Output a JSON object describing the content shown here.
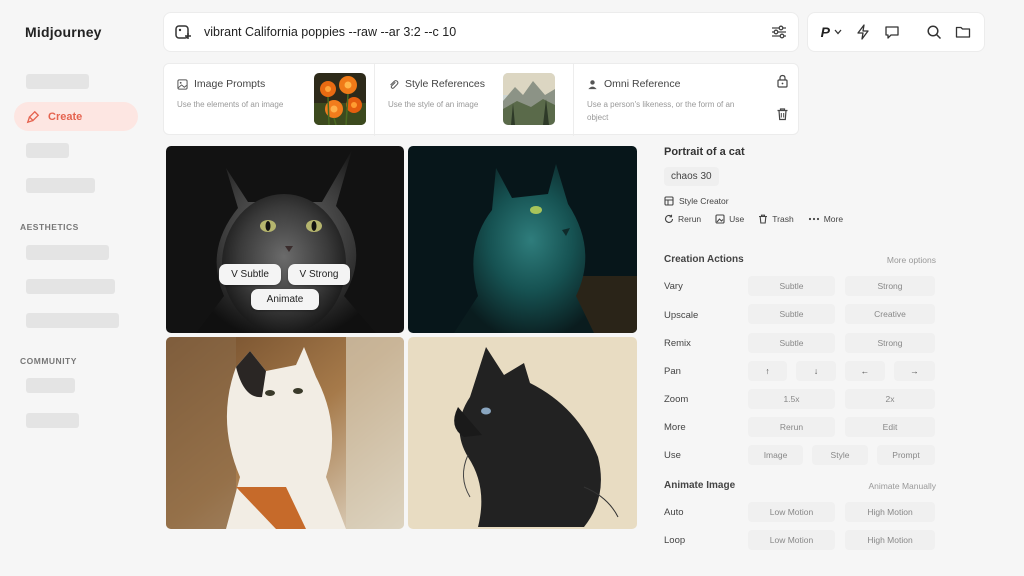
{
  "app": {
    "name": "Midjourney"
  },
  "sidebar": {
    "create_label": "Create",
    "section_aesthetics": "AESTHETICS",
    "section_community": "COMMUNITY",
    "accent": "#e5634f"
  },
  "prompt": {
    "text": "vibrant California poppies --raw --ar 3:2 --c 10"
  },
  "topbar": {
    "profile_label": "P"
  },
  "references": {
    "image_prompts": {
      "title": "Image Prompts",
      "subtitle": "Use the elements of an image"
    },
    "style_references": {
      "title": "Style References",
      "subtitle": "Use the style of an image"
    },
    "omni_reference": {
      "title": "Omni Reference",
      "subtitle": "Use a person's likeness, or the form of an object"
    }
  },
  "image_overlay": {
    "subtle": "V Subtle",
    "strong": "V Strong",
    "animate": "Animate"
  },
  "detail": {
    "title": "Portrait of a cat",
    "chip": "chaos 30",
    "style_creator": "Style Creator",
    "actions": {
      "rerun": "Rerun",
      "use": "Use",
      "trash": "Trash",
      "more": "More"
    }
  },
  "creation": {
    "header": "Creation Actions",
    "more_options": "More options",
    "vary": {
      "label": "Vary",
      "b1": "Subtle",
      "b2": "Strong"
    },
    "upscale": {
      "label": "Upscale",
      "b1": "Subtle",
      "b2": "Creative"
    },
    "remix": {
      "label": "Remix",
      "b1": "Subtle",
      "b2": "Strong"
    },
    "pan": {
      "label": "Pan",
      "b1": "↑",
      "b2": "↓",
      "b3": "←",
      "b4": "→"
    },
    "zoom": {
      "label": "Zoom",
      "b1": "1.5x",
      "b2": "2x"
    },
    "more": {
      "label": "More",
      "b1": "Rerun",
      "b2": "Edit"
    },
    "use": {
      "label": "Use",
      "b1": "Image",
      "b2": "Style",
      "b3": "Prompt"
    }
  },
  "animate": {
    "header": "Animate Image",
    "manual": "Animate Manually",
    "auto": {
      "label": "Auto",
      "b1": "Low Motion",
      "b2": "High Motion"
    },
    "loop": {
      "label": "Loop",
      "b1": "Low Motion",
      "b2": "High Motion"
    }
  }
}
